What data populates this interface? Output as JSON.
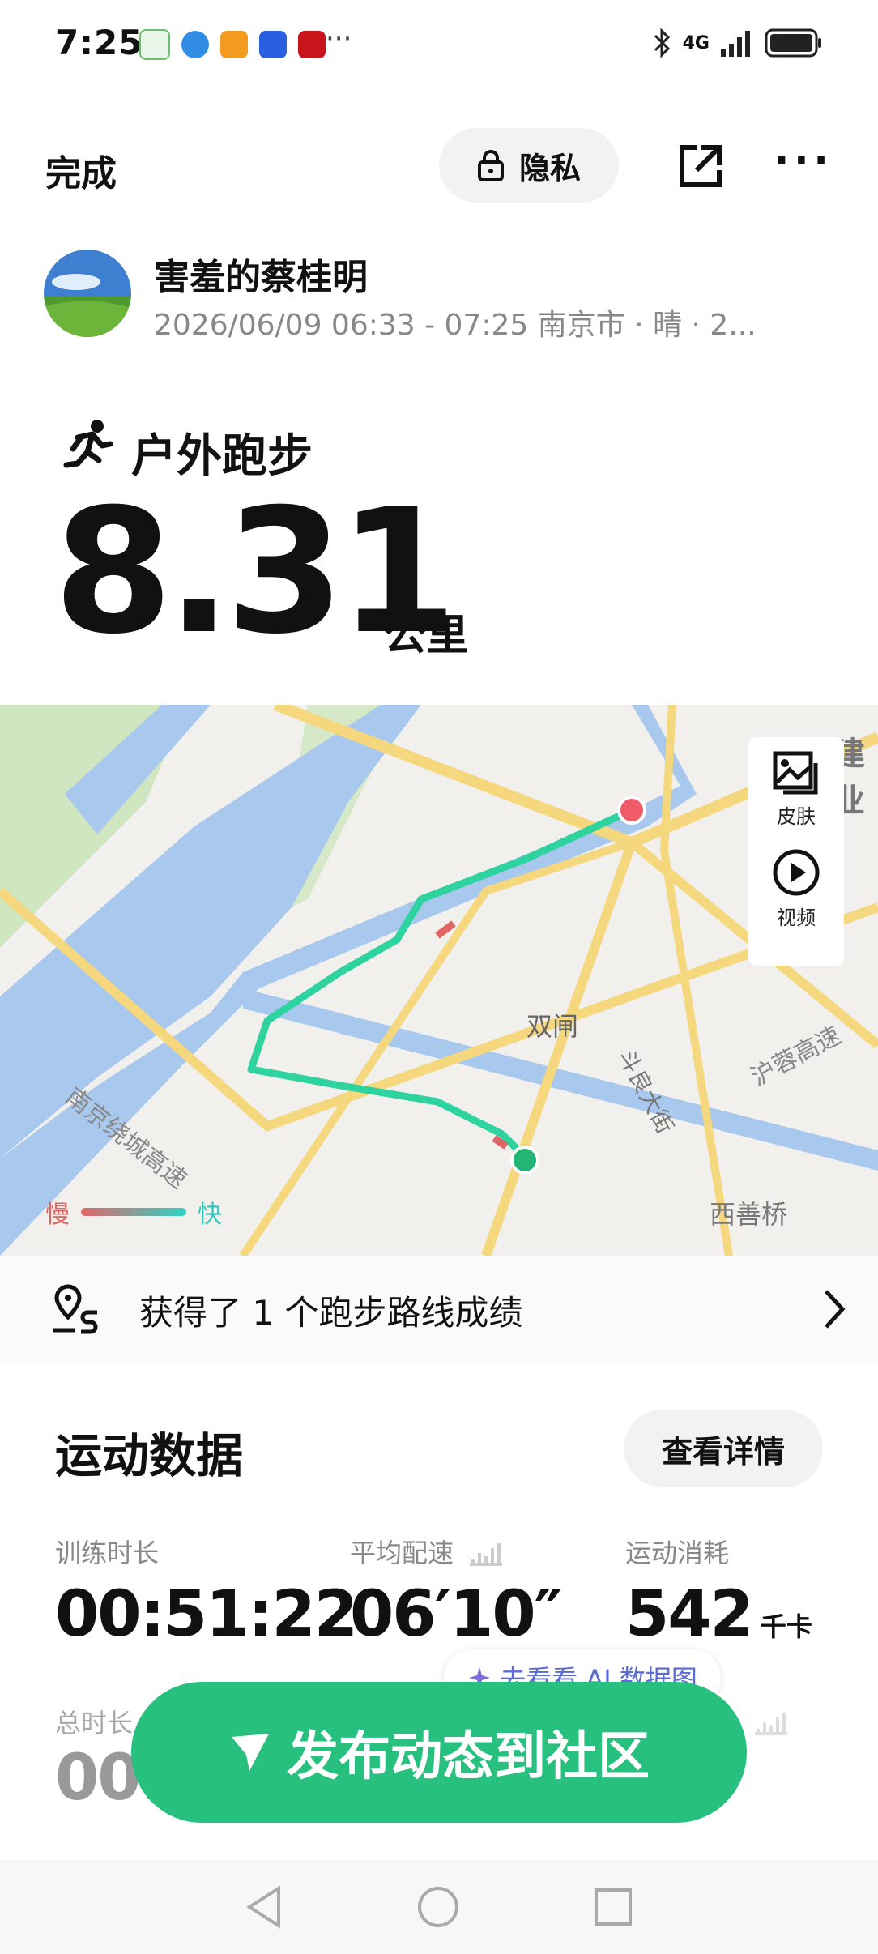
{
  "status_bar": {
    "time": "7:25",
    "more": "···",
    "network": "4G"
  },
  "header": {
    "done_label": "完成",
    "privacy_label": "隐私",
    "more_label": "···"
  },
  "user": {
    "name": "害羞的蔡桂明",
    "meta": "2026/06/09 06:33 - 07:25 南京市 · 晴 · 2..."
  },
  "activity": {
    "type": "户外跑步",
    "distance": "8.31",
    "unit": "公里"
  },
  "map": {
    "skin_label": "皮肤",
    "video_label": "视频",
    "legend_slow": "慢",
    "legend_fast": "快",
    "places": [
      "双闸",
      "斗良大街",
      "南京绕城高速",
      "沪蓉高速",
      "西善桥",
      "建业"
    ]
  },
  "route_banner": {
    "text": "获得了 1 个跑步路线成绩"
  },
  "stats": {
    "title": "运动数据",
    "detail_label": "查看详情",
    "items": [
      {
        "label": "训练时长",
        "value": "00:51:22",
        "unit": ""
      },
      {
        "label": "平均配速",
        "value": "06′10″",
        "unit": ""
      },
      {
        "label": "运动消耗",
        "value": "542",
        "unit": "千卡"
      }
    ],
    "row2_label": "总时长",
    "row2_partial": "00:"
  },
  "ai_chip": {
    "label": "去看看 AI 数据图"
  },
  "publish": {
    "label": "发布动态到社区"
  },
  "colors": {
    "accent": "#27c07f",
    "route_fast": "#2fd3c6",
    "route_slow": "#e06666",
    "water": "#a8c8ee"
  }
}
